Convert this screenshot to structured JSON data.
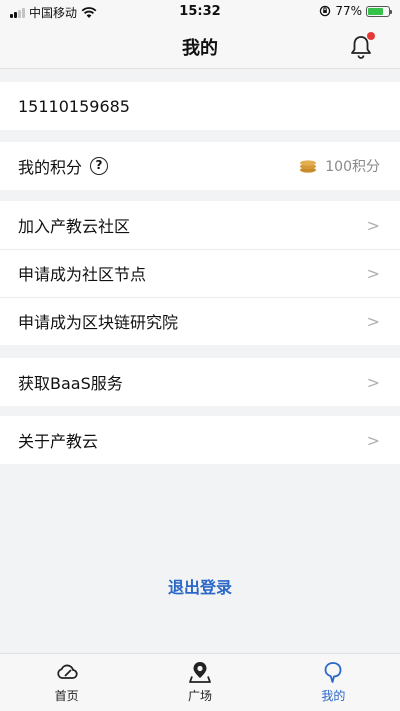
{
  "status_bar": {
    "carrier": "中国移动",
    "time": "15:32",
    "battery": "77%",
    "battery_level": 0.77
  },
  "header": {
    "title": "我的",
    "has_notification_dot": true
  },
  "account": {
    "phone": "15110159685"
  },
  "points": {
    "label": "我的积分",
    "help": "?",
    "value": "100积分"
  },
  "menu_group_1": [
    {
      "label": "加入产教云社区",
      "chevron": ">"
    },
    {
      "label": "申请成为社区节点",
      "chevron": ">"
    },
    {
      "label": "申请成为区块链研究院",
      "chevron": ">"
    }
  ],
  "menu_group_2": [
    {
      "label": "获取BaaS服务",
      "chevron": ">"
    }
  ],
  "menu_group_3": [
    {
      "label": "关于产教云",
      "chevron": ">"
    }
  ],
  "logout_label": "退出登录",
  "tabbar": {
    "items": [
      {
        "label": "首页",
        "icon": "cloud-icon"
      },
      {
        "label": "广场",
        "icon": "map-pin-icon"
      },
      {
        "label": "我的",
        "icon": "profile-icon",
        "active": true
      }
    ]
  },
  "colors": {
    "accent": "#2a67c6",
    "notification": "#e53935",
    "battery": "#35c24a",
    "coin": "#d59a3a"
  }
}
